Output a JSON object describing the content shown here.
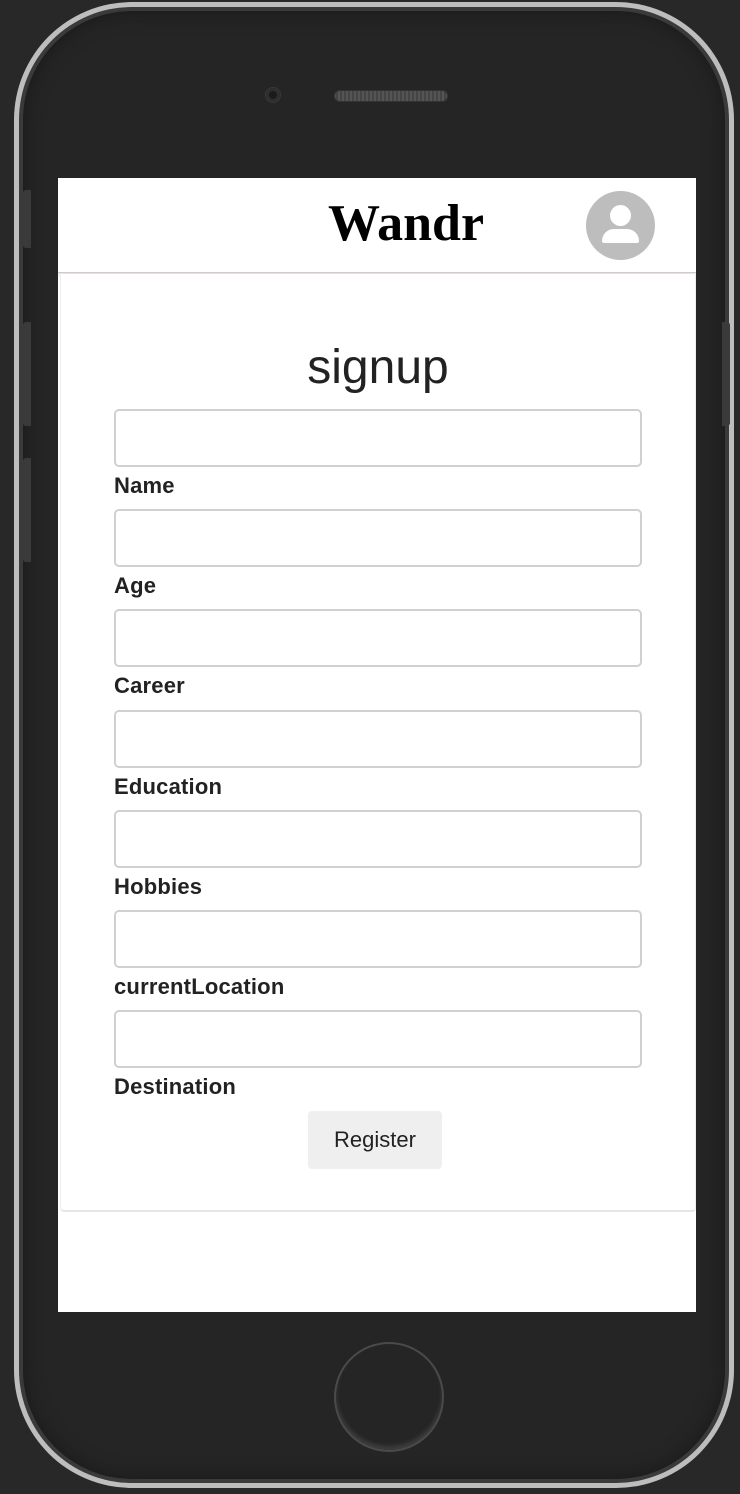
{
  "app": {
    "title": "Wandr"
  },
  "form": {
    "title": "signup",
    "fields": [
      {
        "label": "Name",
        "value": "",
        "placeholder": ""
      },
      {
        "label": "Age",
        "value": "",
        "placeholder": ""
      },
      {
        "label": "Career",
        "value": "",
        "placeholder": ""
      },
      {
        "label": "Education",
        "value": "",
        "placeholder": ""
      },
      {
        "label": "Hobbies",
        "value": "",
        "placeholder": ""
      },
      {
        "label": "currentLocation",
        "value": "",
        "placeholder": ""
      },
      {
        "label": "Destination",
        "value": "",
        "placeholder": ""
      }
    ],
    "submit_label": "Register"
  },
  "icons": {
    "avatar": "user-avatar-icon"
  },
  "colors": {
    "avatar_bg": "#bdbdbd",
    "button_bg": "#efefef",
    "input_border": "#d0d0d0"
  }
}
